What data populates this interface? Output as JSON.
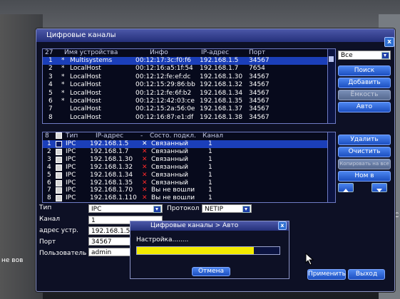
{
  "window": {
    "title": "Цифровые каналы"
  },
  "devices": {
    "count": "27",
    "headers": {
      "name": "Имя устройства",
      "info": "Инфо",
      "ip": "IP-адрес",
      "port": "Порт"
    },
    "rows": [
      {
        "num": "1",
        "mark": "*",
        "name": "Multisystems",
        "info": "00:12:17:3c:f0:f6",
        "ip": "192.168.1.5",
        "port": "34567"
      },
      {
        "num": "2",
        "mark": "*",
        "name": "LocalHost",
        "info": "00:12:16:a5:1f:54",
        "ip": "192.168.1.7",
        "port": "7654"
      },
      {
        "num": "3",
        "mark": "*",
        "name": "LocalHost",
        "info": "00:12:12:fe:ef:dc",
        "ip": "192.168.1.30",
        "port": "34567"
      },
      {
        "num": "4",
        "mark": "*",
        "name": "LocalHost",
        "info": "00:12:15:29:86:bb",
        "ip": "192.168.1.32",
        "port": "34567"
      },
      {
        "num": "5",
        "mark": "*",
        "name": "LocalHost",
        "info": "00:12:12:fe:6f:b2",
        "ip": "192.168.1.34",
        "port": "34567"
      },
      {
        "num": "6",
        "mark": "*",
        "name": "LocalHost",
        "info": "00:12:12:42:03:ce",
        "ip": "192.168.1.35",
        "port": "34567"
      },
      {
        "num": "7",
        "mark": "",
        "name": "LocalHost",
        "info": "00:12:15:2a:56:0e",
        "ip": "192.168.1.37",
        "port": "34567"
      },
      {
        "num": "8",
        "mark": "",
        "name": "LocalHost",
        "info": "00:12:16:87:e1:df",
        "ip": "192.168.1.38",
        "port": "34567"
      }
    ]
  },
  "right_panel": {
    "filter": "Все",
    "search": "Поиск",
    "add": "Добавить",
    "disabled": "Ёмкость",
    "auto": "Авто"
  },
  "channels": {
    "count": "8",
    "headers": {
      "type": "Тип",
      "ip": "IP-адрес",
      "dash": "-",
      "state": "Состо. подкл.",
      "channel": "Канал"
    },
    "rows": [
      {
        "num": "1",
        "checked": true,
        "type": "IPC",
        "ip": "192.168.1.5",
        "state": "Связанный",
        "channel": "1"
      },
      {
        "num": "2",
        "checked": false,
        "type": "IPC",
        "ip": "192.168.1.7",
        "state": "Связанный",
        "channel": "1"
      },
      {
        "num": "3",
        "checked": false,
        "type": "IPC",
        "ip": "192.168.1.30",
        "state": "Связанный",
        "channel": "1"
      },
      {
        "num": "4",
        "checked": false,
        "type": "IPC",
        "ip": "192.168.1.32",
        "state": "Связанный",
        "channel": "1"
      },
      {
        "num": "5",
        "checked": false,
        "type": "IPC",
        "ip": "192.168.1.34",
        "state": "Связанный",
        "channel": "1"
      },
      {
        "num": "6",
        "checked": false,
        "type": "IPC",
        "ip": "192.168.1.35",
        "state": "Связанный",
        "channel": "1"
      },
      {
        "num": "7",
        "checked": false,
        "type": "IPC",
        "ip": "192.168.1.70",
        "state": "Вы не вошли",
        "channel": "1"
      },
      {
        "num": "8",
        "checked": false,
        "type": "IPC",
        "ip": "192.168.1.110",
        "state": "Вы не вошли",
        "channel": "1"
      }
    ]
  },
  "right_panel2": {
    "delete": "Удалить",
    "clear": "Очистить",
    "disabled": "Копировать на все",
    "nom": "Ном в"
  },
  "form": {
    "type_label": "Тип",
    "type_value": "IPC",
    "protocol_label": "Протокол",
    "protocol_value": "NETIP",
    "channel_label": "Канал",
    "channel_value": "1",
    "address_label": "адрес устр.",
    "address_value": "192.168.1.5",
    "port_label": "Порт",
    "port_value": "34567",
    "user_label": "Пользователь",
    "user_value": "admin"
  },
  "footer": {
    "apply": "Применить",
    "exit": "Выход"
  },
  "dialog": {
    "title": "Цифровые каналы > Авто",
    "status": "Настройка........",
    "cancel": "Отмена",
    "progress": 0.82
  },
  "edge": {
    "left_text": "не вов",
    "right_text": "С"
  }
}
